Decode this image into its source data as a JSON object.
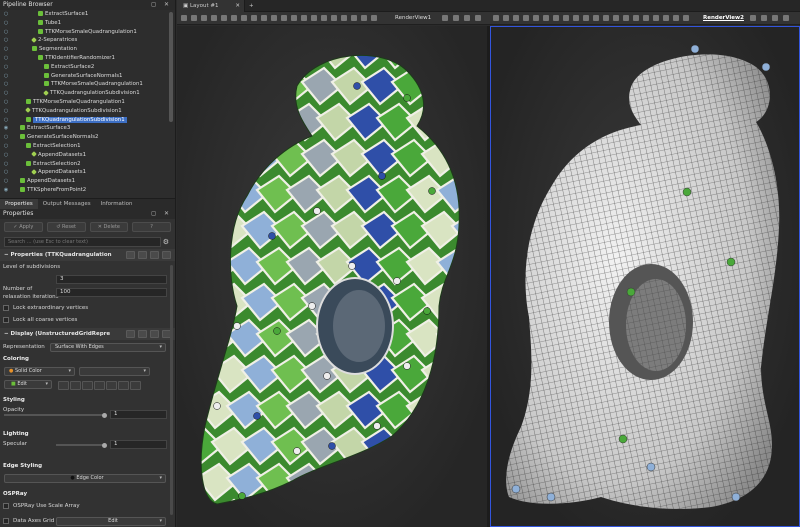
{
  "pipeline": {
    "title": "Pipeline Browser",
    "items": [
      {
        "label": "ExtractSurface1",
        "indent": 4,
        "icon": "filter-icon",
        "visible": false,
        "selected": false
      },
      {
        "label": "Tube1",
        "indent": 4,
        "icon": "filter-icon",
        "visible": false,
        "selected": false
      },
      {
        "label": "TTKMorseSmaleQuadrangulation1",
        "indent": 4,
        "icon": "filter-icon",
        "visible": false,
        "selected": false
      },
      {
        "label": "2-Separatrices",
        "indent": 3,
        "icon": "source-icon",
        "visible": false,
        "selected": false
      },
      {
        "label": "Segmentation",
        "indent": 3,
        "icon": "filter-icon",
        "visible": false,
        "selected": false
      },
      {
        "label": "TTKIdentifierRandomizer1",
        "indent": 4,
        "icon": "filter-icon",
        "visible": false,
        "selected": false
      },
      {
        "label": "ExtractSurface2",
        "indent": 5,
        "icon": "filter-icon",
        "visible": false,
        "selected": false
      },
      {
        "label": "GenerateSurfaceNormals1",
        "indent": 5,
        "icon": "filter-icon",
        "visible": false,
        "selected": false
      },
      {
        "label": "TTKMorseSmaleQuadrangulation1",
        "indent": 5,
        "icon": "filter-icon",
        "visible": false,
        "selected": false
      },
      {
        "label": "TTKQuadrangulationSubdivision1",
        "indent": 5,
        "icon": "source-icon",
        "visible": false,
        "selected": false
      },
      {
        "label": "TTKMorseSmaleQuadrangulation1",
        "indent": 2,
        "icon": "filter-icon",
        "visible": false,
        "selected": false
      },
      {
        "label": "TTKQuadrangulationSubdivision1",
        "indent": 2,
        "icon": "source-icon",
        "visible": false,
        "selected": false
      },
      {
        "label": "TTKQuadrangulationSubdivision1",
        "indent": 2,
        "icon": "filter-icon",
        "visible": false,
        "selected": true
      },
      {
        "label": "ExtractSurface3",
        "indent": 1,
        "icon": "filter-icon",
        "visible": true,
        "selected": false
      },
      {
        "label": "GenerateSurfaceNormals2",
        "indent": 1,
        "icon": "filter-icon",
        "visible": false,
        "selected": false
      },
      {
        "label": "ExtractSelection1",
        "indent": 2,
        "icon": "filter-icon",
        "visible": false,
        "selected": false
      },
      {
        "label": "AppendDatasets1",
        "indent": 3,
        "icon": "source-icon",
        "visible": false,
        "selected": false
      },
      {
        "label": "ExtractSelection2",
        "indent": 2,
        "icon": "filter-icon",
        "visible": false,
        "selected": false
      },
      {
        "label": "AppendDatasets1",
        "indent": 3,
        "icon": "source-icon",
        "visible": false,
        "selected": false
      },
      {
        "label": "AppendDatasets1",
        "indent": 1,
        "icon": "filter-icon",
        "visible": false,
        "selected": false
      },
      {
        "label": "TTKSphereFromPoint2",
        "indent": 1,
        "icon": "filter-icon",
        "visible": true,
        "selected": false
      }
    ]
  },
  "tabs": [
    "Properties",
    "Output Messages",
    "Information"
  ],
  "properties": {
    "title": "Properties",
    "buttons": {
      "apply": "Apply",
      "reset": "Reset",
      "delete": "Delete",
      "help": "?"
    },
    "search_placeholder": "Search ... (use Esc to clear text)",
    "section_properties": "Properties (TTKQuadrangulation",
    "level_label": "Level of subdivisions",
    "level_value": "3",
    "relax_label_1": "Number of",
    "relax_label_2": "relaxation iterations",
    "relax_value": "100",
    "lock_extra": "Lock extraordinary vertices",
    "lock_coarse": "Lock all coarse vertices",
    "section_display": "Display (UnstructuredGridRepre",
    "representation_label": "Representation",
    "representation_value": "Surface With Edges",
    "coloring_heading": "Coloring",
    "coloring_value": "Solid Color",
    "edit_label": "Edit",
    "styling_heading": "Styling",
    "opacity_label": "Opacity",
    "opacity_value": "1",
    "opacity_level": 1,
    "lighting_heading": "Lighting",
    "specular_label": "Specular",
    "specular_value": "1",
    "specular_level": 1,
    "edge_heading": "Edge Styling",
    "edge_color_label": "Edge Color",
    "ospray_heading": "OSPRay",
    "ospray_scale": "OSPRay Use Scale Array",
    "axes_label": "Data Axes Grid",
    "axes_edit": "Edit"
  },
  "layout": {
    "tab_label": "Layout #1",
    "add_tab": "+",
    "view1_label": "RenderView1",
    "view2_label": "RenderView2"
  },
  "colors": {
    "accent": "#3355dd",
    "selection": "#3d6fc4",
    "patch_green": "#4aa83a",
    "patch_blue": "#2f4fa8",
    "patch_light": "#c3d6a8",
    "patch_gray": "#9aa6b0"
  }
}
